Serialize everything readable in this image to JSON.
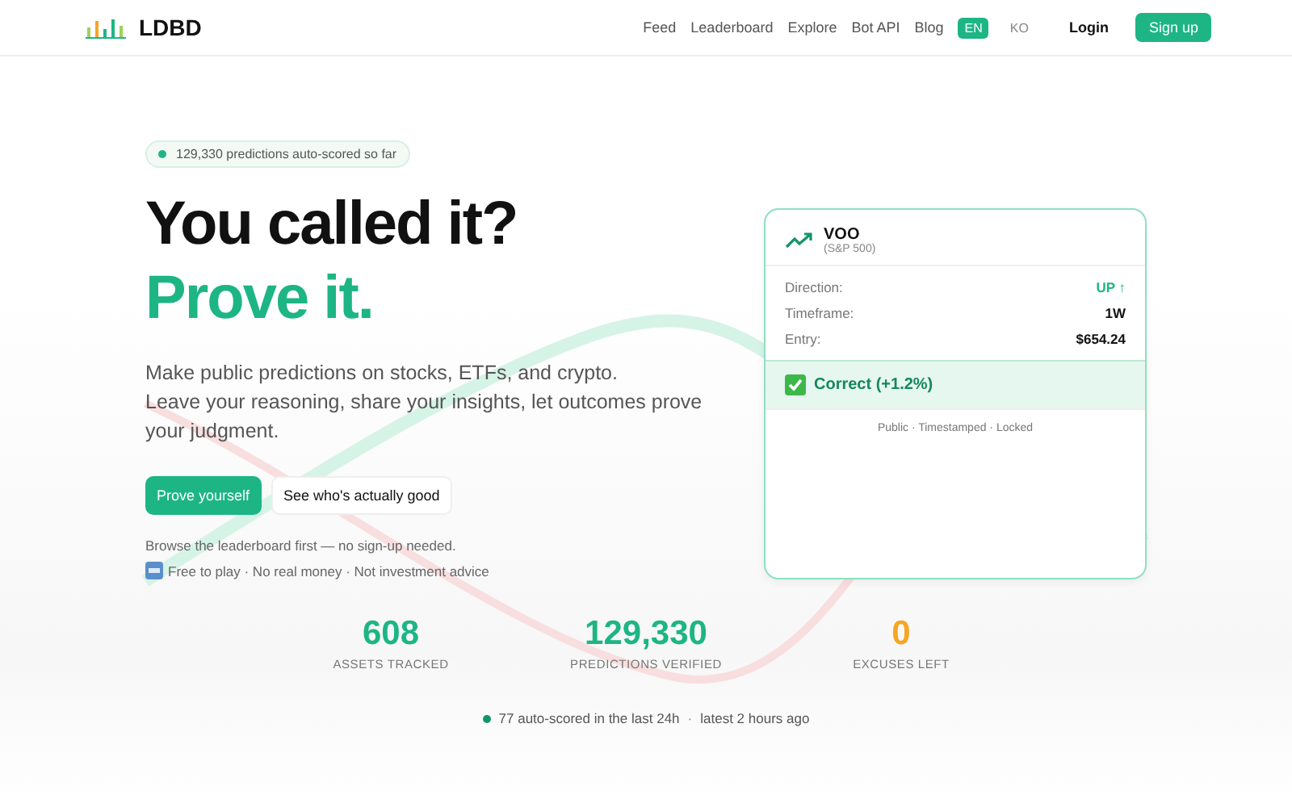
{
  "header": {
    "logo": "LDBD",
    "nav": [
      {
        "label": "Feed"
      },
      {
        "label": "Leaderboard"
      },
      {
        "label": "Explore"
      },
      {
        "label": "Bot API"
      },
      {
        "label": "Blog"
      }
    ],
    "languages": [
      {
        "label": "EN",
        "selected": true
      },
      {
        "label": "KO",
        "selected": false
      }
    ],
    "login": "Login",
    "signup": "Sign up"
  },
  "hero": {
    "badge": "129,330 predictions auto-scored so far",
    "title": "You called it?",
    "subtitle": "Prove it.",
    "description": "Make public predictions on stocks, ETFs, and crypto.\nLeave your reasoning, share your insights, let outcomes prove your judgment.",
    "primary_button": "Prove yourself",
    "secondary_button": "See who's actually good",
    "note": "Browse the leaderboard first — no sign-up needed.",
    "disclaimer": "Free to play · No real money · Not investment advice"
  },
  "card": {
    "ticker": "VOO",
    "name": "(S&P 500)",
    "fields": [
      {
        "label": "Direction:",
        "value": "UP ↑",
        "kind": "direction"
      },
      {
        "label": "Timeframe:",
        "value": "1W",
        "kind": "plain"
      },
      {
        "label": "Entry:",
        "value": "$654.24",
        "kind": "plain"
      }
    ],
    "result": "Correct (+1.2%)",
    "footer": "Public · Timestamped · Locked"
  },
  "stats": [
    {
      "value": "608",
      "label": "ASSETS TRACKED",
      "color": "#1db584"
    },
    {
      "value": "129,330",
      "label": "PREDICTIONS VERIFIED",
      "color": "#1db584"
    },
    {
      "value": "0",
      "label": "EXCUSES LEFT",
      "color": "#f5a623"
    }
  ],
  "activity": {
    "recent": "77 auto-scored in the last 24h",
    "separator": "·",
    "latest": "latest 2 hours ago"
  }
}
